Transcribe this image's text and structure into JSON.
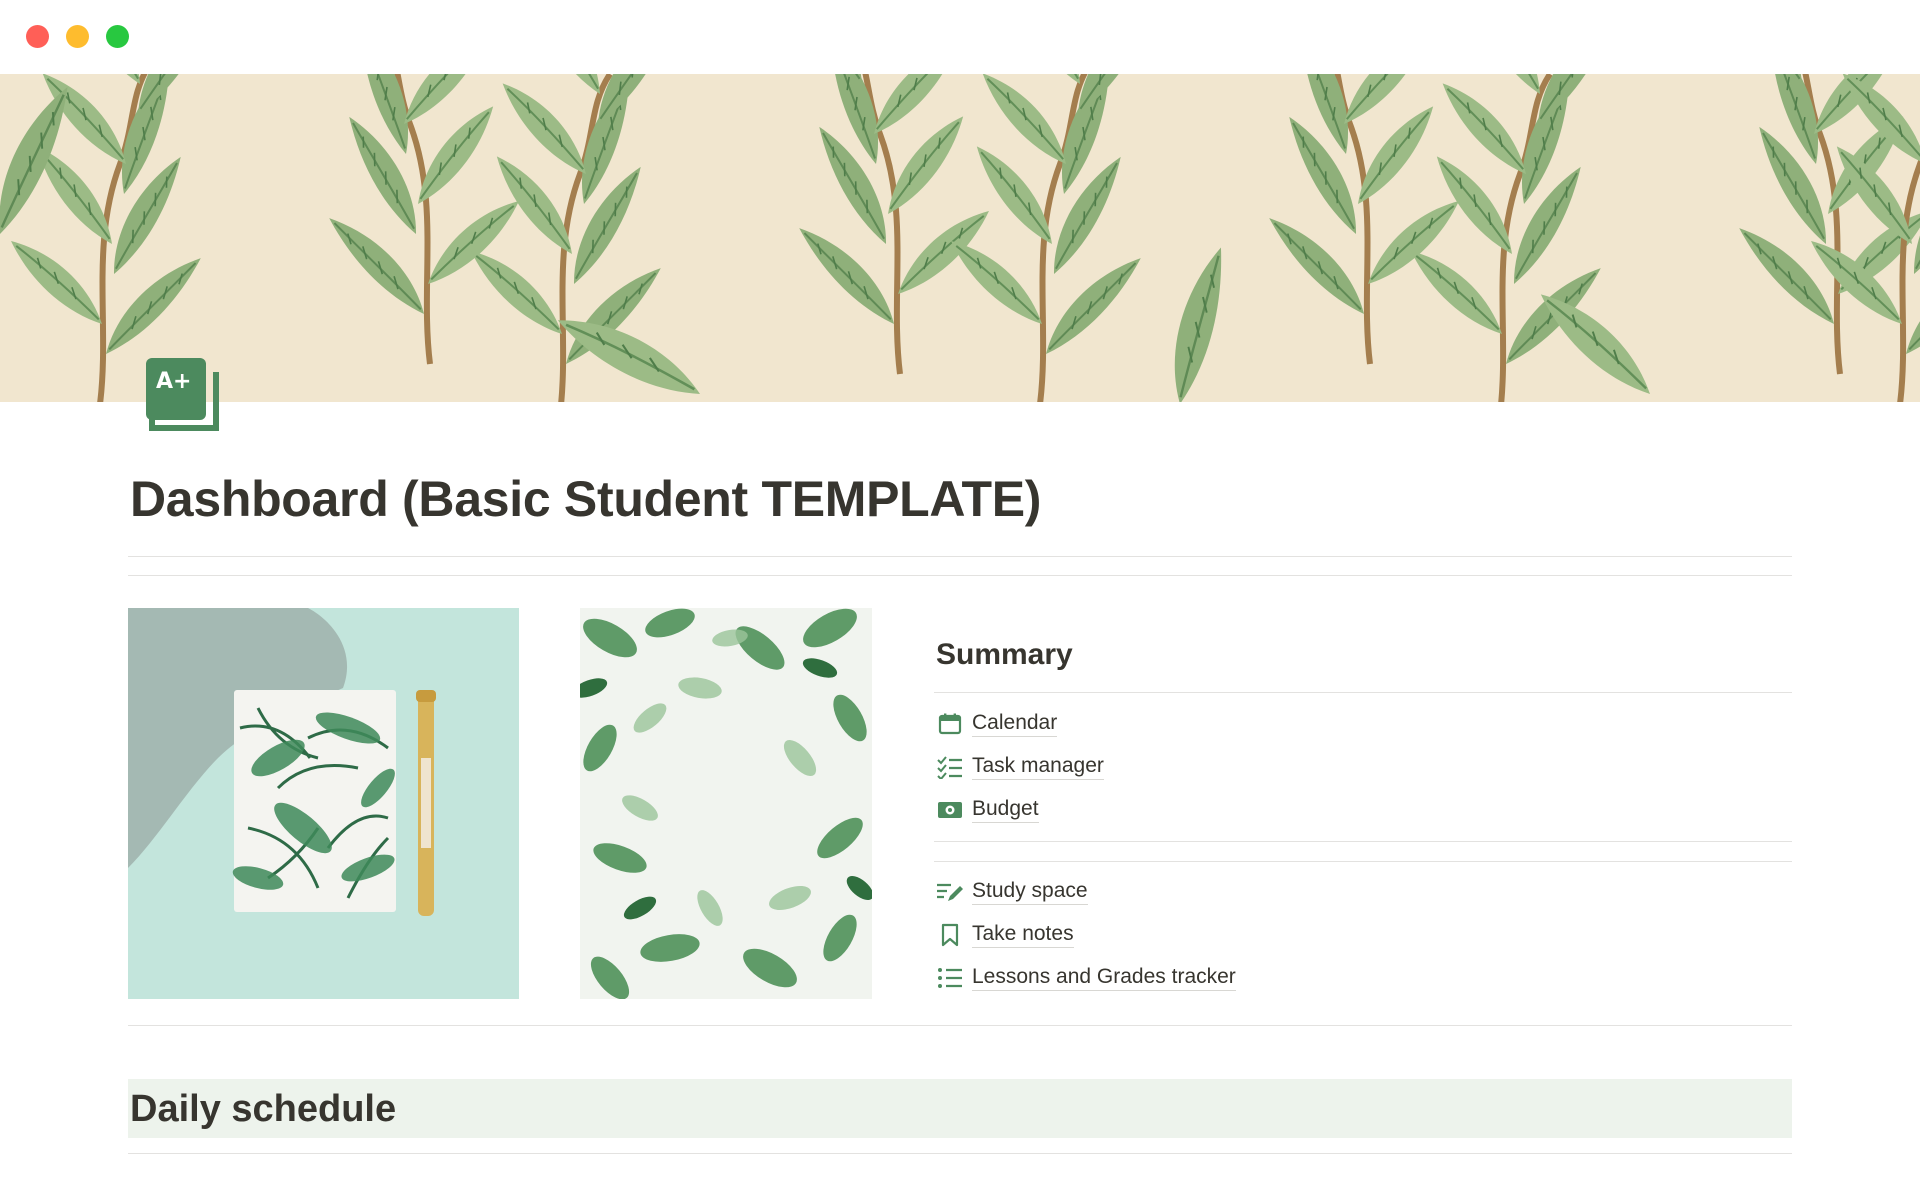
{
  "window": {
    "controls": [
      "close",
      "minimize",
      "maximize"
    ]
  },
  "page": {
    "icon": "grade-a-plus-icon",
    "icon_text": "A+",
    "title": "Dashboard (Basic Student TEMPLATE)"
  },
  "colors": {
    "accent_green": "#4c8a5e",
    "heading_bg": "#edf3ec",
    "text": "#37352f"
  },
  "summary": {
    "heading": "Summary",
    "group1": [
      {
        "label": "Calendar",
        "icon": "calendar-icon"
      },
      {
        "label": "Task manager",
        "icon": "checklist-icon"
      },
      {
        "label": "Budget",
        "icon": "money-icon"
      }
    ],
    "group2": [
      {
        "label": "Study space",
        "icon": "edit-list-icon"
      },
      {
        "label": "Take notes",
        "icon": "bookmark-icon"
      },
      {
        "label": "Lessons and Grades tracker",
        "icon": "list-icon"
      }
    ]
  },
  "daily": {
    "heading": "Daily schedule"
  }
}
